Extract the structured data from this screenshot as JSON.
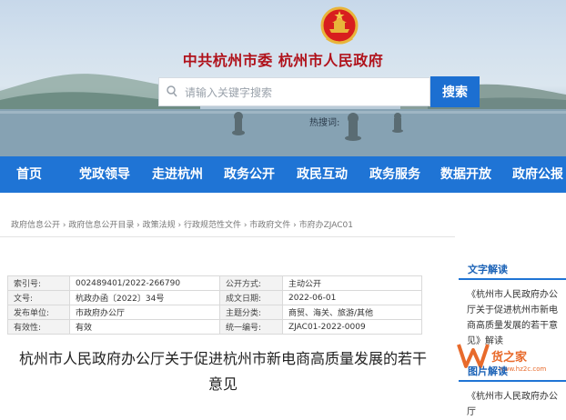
{
  "header": {
    "title": "中共杭州市委  杭州市人民政府",
    "search_placeholder": "请输入关键字搜索",
    "search_button": "搜索",
    "hot_words": "热搜词:"
  },
  "nav": {
    "items": [
      "首页",
      "党政领导",
      "走进杭州",
      "政务公开",
      "政民互动",
      "政务服务",
      "数据开放",
      "政府公报"
    ]
  },
  "breadcrumb": "政府信息公开 › 政府信息公开目录 › 政策法规 › 行政规范性文件 › 市政府文件 › 市府办ZJAC01",
  "meta": {
    "rows": [
      [
        "索引号:",
        "002489401/2022-266790",
        "公开方式:",
        "主动公开"
      ],
      [
        "文号:",
        "杭政办函〔2022〕34号",
        "成文日期:",
        "2022-06-01"
      ],
      [
        "发布单位:",
        "市政府办公厅",
        "主题分类:",
        "商贸、海关、旅游/其他"
      ],
      [
        "有效性:",
        "有效",
        "统一编号:",
        "ZJAC01-2022-0009"
      ]
    ]
  },
  "doc": {
    "title": "杭州市人民政府办公厅关于促进杭州市新电商高质量发展的若干意见"
  },
  "sidebar": {
    "section1": "文字解读",
    "link1": "《杭州市人民政府办公厅关于促进杭州市新电商高质量发展的若干意见》解读",
    "section2": "图片解读",
    "link2": "《杭州市人民政府办公厅"
  },
  "watermark": {
    "text": "货之家",
    "sub": "www.hz2c.com"
  },
  "colors": {
    "nav_blue": "#1f74d5",
    "title_red": "#b0121b",
    "button_blue": "#1c6fd1"
  }
}
